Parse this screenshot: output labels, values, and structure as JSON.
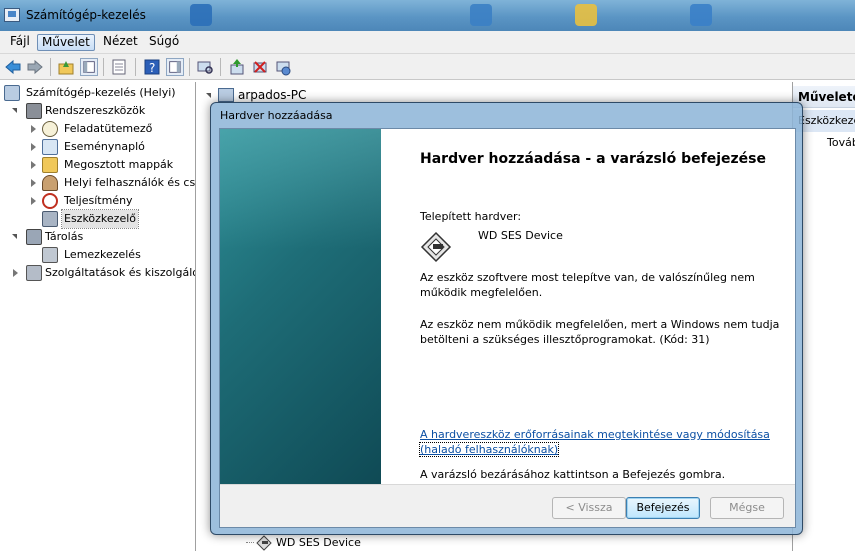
{
  "window": {
    "title": "Számítógép-kezelés"
  },
  "menu": [
    "Fájl",
    "Művelet",
    "Nézet",
    "Súgó"
  ],
  "tree": {
    "root": "Számítógép-kezelés (Helyi)",
    "system_tools": "Rendszereszközök",
    "task_scheduler": "Feladatütemező",
    "event_viewer": "Eseménynapló",
    "shared_folders": "Megosztott mappák",
    "local_users": "Helyi felhasználók és cs",
    "performance": "Teljesítmény",
    "device_manager": "Eszközkezelő",
    "storage": "Tárolás",
    "disk_management": "Lemezkezelés",
    "services": "Szolgáltatások és kiszolgáló"
  },
  "middle": {
    "root": "arpados-PC",
    "bottom_item": "WD SES Device"
  },
  "actions": {
    "header": "Műveletek",
    "section": "Eszközkezelő",
    "more": "További"
  },
  "dialog": {
    "title": "Hardver hozzáadása",
    "heading": "Hardver hozzáadása - a varázsló befejezése",
    "installed_label": "Telepített hardver:",
    "device_name": "WD SES Device",
    "msg1": "Az eszköz szoftvere most telepítve van, de valószínűleg nem működik megfelelően.",
    "msg2": "Az eszköz nem működik megfelelően, mert a Windows nem tudja betölteni a szükséges illesztőprogramokat. (Kód: 31)",
    "link_line1": "A hardvereszköz erőforrásainak megtekintése vagy módosítása",
    "link_line2": "(haladó felhasználóknak)",
    "finish_hint": "A varázsló bezárásához kattintson a Befejezés gombra.",
    "back_button": "< Vissza",
    "finish_button": "Befejezés",
    "cancel_button": "Mégse"
  },
  "colors": {
    "accent": "#3c7fb1",
    "link": "#0b4fa3",
    "wizard_panel": "#1e6d77"
  }
}
